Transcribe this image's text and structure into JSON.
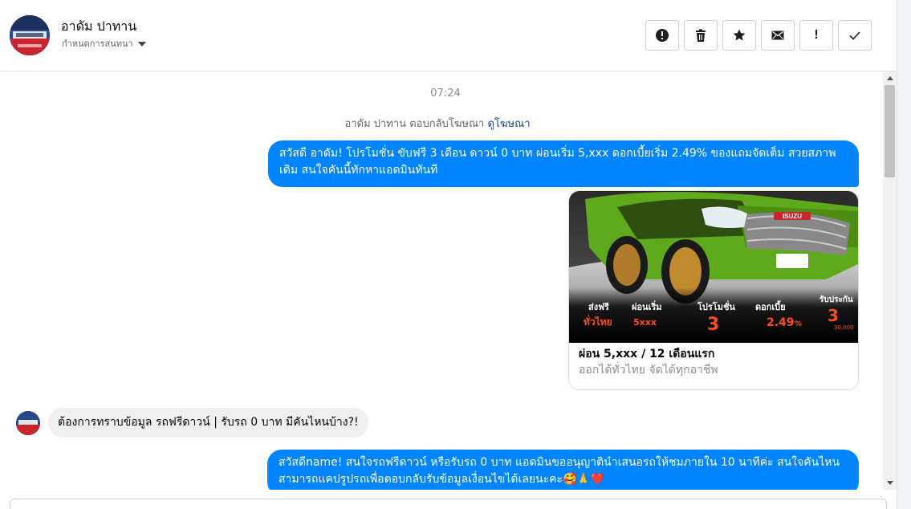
{
  "header": {
    "contact_name": "อาดัม ปาทาน",
    "assign_label": "กำหนดการสนทนา"
  },
  "toolbar": {
    "items": [
      {
        "name": "spam",
        "icon": "alert-circle-icon"
      },
      {
        "name": "delete",
        "icon": "trash-icon"
      },
      {
        "name": "star",
        "icon": "star-icon"
      },
      {
        "name": "mark-unread",
        "icon": "envelope-icon"
      },
      {
        "name": "follow-up",
        "icon": "exclamation-icon",
        "glyph": "!"
      },
      {
        "name": "done",
        "icon": "check-icon"
      }
    ]
  },
  "chat": {
    "timestamp": "07:24",
    "reply_note_prefix": "อาดัม ปาทาน ตอบกลับโฆษณา",
    "reply_note_link": "ดูโฆษณา",
    "outgoing_1": "สวัสดี อาดัม! โปรโมชั่น ขับฟรี 3 เดือน ดาวน์ 0 บาท ผ่อนเริ่ม 5,xxx  ดอกเบี้ยเริ่ม 2.49% ของแถมจัดเต็ม สวยสภาพเดิม สนใจคันนี้ทักหาแอดมินทันที",
    "ad_card": {
      "image_text": {
        "brand": "ISUZU",
        "col1_top": "ส่งฟรี",
        "col1_bottom": "ทั่วไทย",
        "col2_top": "ผ่อนเริ่ม",
        "col2_value": "5xxx",
        "col3_top": "โปรโมชั่น",
        "col3_value": "3",
        "col4_top": "ดอกเบี้ย",
        "col4_value": "2.49",
        "col4_unit": "%",
        "col5_top": "รับประกัน",
        "col5_value": "3",
        "col5_sub": "30,000"
      },
      "title": "ผ่อน 5,xxx / 12 เดือนแรก",
      "subtitle": "ออกได้ทั่วไทย จัดได้ทุกอาชีพ"
    },
    "incoming_1": "ต้องการทราบข้อมูล รถฟรีดาวน์ | รับรถ 0 บาท มีคันไหนบ้าง?!",
    "outgoing_2": "สวัสดีname! สนใจรถฟรีดาวน์ หรือรับรถ 0 บาท แอดมินขออนุญาตินำเสนอรถให้ชมภายใน 10 นาทีค่ะ สนใจคันไหนสามารถแคปรูปรถเพื่อตอบกลับรับข้อมูลเงื่อนไขได้เลยนะคะ🥰🙏❤️"
  },
  "colors": {
    "outgoing_bubble": "#0084ff",
    "incoming_bubble": "#f0f0f0",
    "link": "#1c4587",
    "car_green": "#5fa91c",
    "promo_orange": "#ff4a1c"
  }
}
